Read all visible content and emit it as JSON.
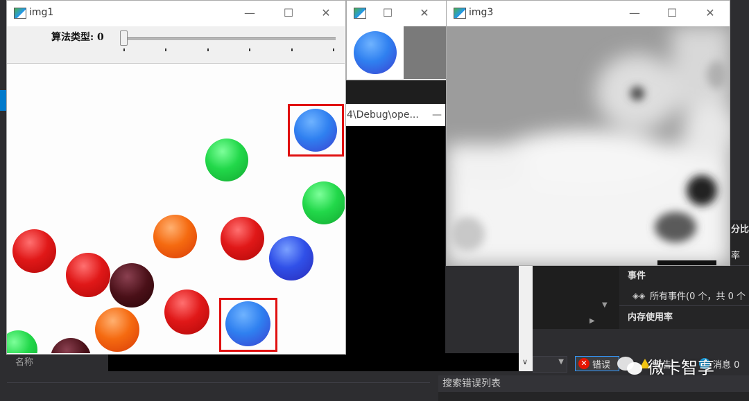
{
  "ide": {
    "right_panel": {
      "top_partial_label": "分比",
      "rate_partial_label": "率",
      "events_header": "事件",
      "all_events": "所有事件(0 个，共 0 个",
      "memory_header": "内存使用率"
    },
    "error_list": {
      "errors_label": "错误",
      "warnings_label": "警告",
      "messages_label": "消息 0",
      "search_placeholder": "搜索错误列表"
    },
    "bottom_left": {
      "name_label": "名称"
    }
  },
  "watermark": {
    "text": "微卡智享"
  },
  "windows": {
    "img1": {
      "title": "img1",
      "trackbar_label": "算法类型: 0",
      "trackbar_value": 0
    },
    "img2": {
      "title": ""
    },
    "console": {
      "title": "4\\Debug\\ope..."
    },
    "img3": {
      "title": "img3"
    }
  },
  "titlebar_buttons": {
    "minimize": "—",
    "maximize": "☐",
    "close": "✕"
  },
  "colors": {
    "blue_candy": "#3a7be8",
    "green_candy": "#22d84a",
    "red_candy": "#e01818",
    "orange_candy": "#f25a10",
    "brown_candy": "#4a1018",
    "highlight_box": "#e01010"
  }
}
